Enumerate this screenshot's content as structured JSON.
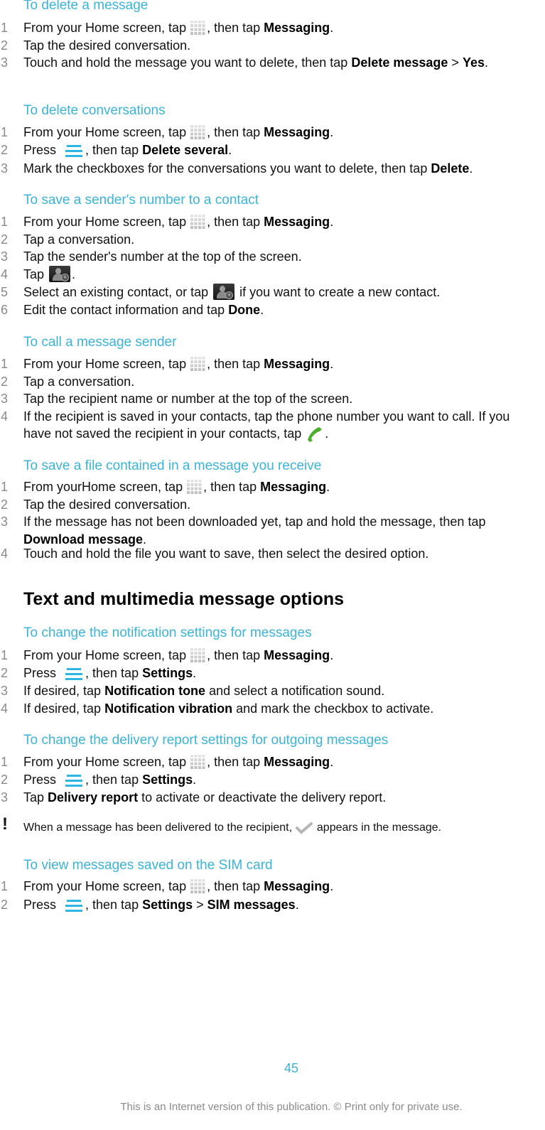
{
  "colors": {
    "heading_accent": "#3bb4d9",
    "step_number": "#8a8a8a",
    "menu_icon": "#2cb7e3",
    "phone_icon": "#4caf2f"
  },
  "procedures": [
    {
      "title": "To delete a message",
      "steps": [
        {
          "n": "1",
          "parts": [
            [
              "t",
              "From your Home screen, tap "
            ],
            [
              "icon",
              "apps-icon"
            ],
            [
              "t",
              ", then tap "
            ],
            [
              "b",
              "Messaging"
            ],
            [
              "t",
              "."
            ]
          ]
        },
        {
          "n": "2",
          "parts": [
            [
              "t",
              "Tap the desired conversation."
            ]
          ]
        },
        {
          "n": "3",
          "parts": [
            [
              "t",
              "Touch and hold the message you want to delete, then tap "
            ],
            [
              "b",
              "Delete message"
            ],
            [
              "t",
              " > "
            ],
            [
              "b",
              "Yes"
            ],
            [
              "t",
              "."
            ]
          ]
        }
      ]
    },
    {
      "title": "To delete conversations",
      "steps": [
        {
          "n": "1",
          "parts": [
            [
              "t",
              "From your Home screen, tap "
            ],
            [
              "icon",
              "apps-icon"
            ],
            [
              "t",
              ", then tap "
            ],
            [
              "b",
              "Messaging"
            ],
            [
              "t",
              "."
            ]
          ]
        },
        {
          "n": "2",
          "parts": [
            [
              "t",
              "Press "
            ],
            [
              "icon",
              "menu-icon"
            ],
            [
              "t",
              ", then tap "
            ],
            [
              "b",
              "Delete several"
            ],
            [
              "t",
              "."
            ]
          ]
        },
        {
          "n": "3",
          "parts": [
            [
              "t",
              "Mark the checkboxes for the conversations you want to delete, then tap "
            ],
            [
              "b",
              "Delete"
            ],
            [
              "t",
              "."
            ]
          ]
        }
      ]
    },
    {
      "title": "To save a sender's number to a contact",
      "steps": [
        {
          "n": "1",
          "parts": [
            [
              "t",
              "From your Home screen, tap "
            ],
            [
              "icon",
              "apps-icon"
            ],
            [
              "t",
              ", then tap "
            ],
            [
              "b",
              "Messaging"
            ],
            [
              "t",
              "."
            ]
          ]
        },
        {
          "n": "2",
          "parts": [
            [
              "t",
              "Tap a conversation."
            ]
          ]
        },
        {
          "n": "3",
          "parts": [
            [
              "t",
              "Tap the sender's number at the top of the screen."
            ]
          ]
        },
        {
          "n": "4",
          "parts": [
            [
              "t",
              "Tap "
            ],
            [
              "icon",
              "add-contact-icon"
            ],
            [
              "t",
              "."
            ]
          ]
        },
        {
          "n": "5",
          "parts": [
            [
              "t",
              "Select an existing contact, or tap "
            ],
            [
              "icon",
              "add-contact-icon"
            ],
            [
              "t",
              " if you want to create a new contact."
            ]
          ]
        },
        {
          "n": "6",
          "parts": [
            [
              "t",
              "Edit the contact information and tap "
            ],
            [
              "b",
              "Done"
            ],
            [
              "t",
              "."
            ]
          ]
        }
      ]
    },
    {
      "title": "To call a message sender",
      "steps": [
        {
          "n": "1",
          "parts": [
            [
              "t",
              "From your Home screen, tap "
            ],
            [
              "icon",
              "apps-icon"
            ],
            [
              "t",
              ", then tap "
            ],
            [
              "b",
              "Messaging"
            ],
            [
              "t",
              "."
            ]
          ]
        },
        {
          "n": "2",
          "parts": [
            [
              "t",
              "Tap a conversation."
            ]
          ]
        },
        {
          "n": "3",
          "parts": [
            [
              "t",
              "Tap the recipient name or number at the top of the screen."
            ]
          ]
        },
        {
          "n": "4",
          "parts": [
            [
              "t",
              "If the recipient is saved in your contacts, tap the phone number you want to call. If you have not saved the recipient in your contacts, tap "
            ],
            [
              "icon",
              "phone-icon"
            ],
            [
              "t",
              "."
            ]
          ]
        }
      ]
    },
    {
      "title": "To save a file contained in a message you receive",
      "steps": [
        {
          "n": "1",
          "parts": [
            [
              "t",
              "From yourHome screen, tap "
            ],
            [
              "icon",
              "apps-icon"
            ],
            [
              "t",
              ", then tap "
            ],
            [
              "b",
              "Messaging"
            ],
            [
              "t",
              "."
            ]
          ]
        },
        {
          "n": "2",
          "parts": [
            [
              "t",
              "Tap the desired conversation."
            ]
          ]
        },
        {
          "n": "3",
          "parts": [
            [
              "t",
              "If the message has not been downloaded yet, tap and hold the message, then tap "
            ],
            [
              "b",
              "Download message"
            ],
            [
              "t",
              "."
            ]
          ]
        },
        {
          "n": "4",
          "parts": [
            [
              "t",
              "Touch and hold the file you want to save, then select the desired option."
            ]
          ]
        }
      ]
    },
    {
      "title": "To change the notification settings for messages",
      "steps": [
        {
          "n": "1",
          "parts": [
            [
              "t",
              "From your Home screen, tap "
            ],
            [
              "icon",
              "apps-icon"
            ],
            [
              "t",
              ", then tap "
            ],
            [
              "b",
              "Messaging"
            ],
            [
              "t",
              "."
            ]
          ]
        },
        {
          "n": "2",
          "parts": [
            [
              "t",
              "Press "
            ],
            [
              "icon",
              "menu-icon"
            ],
            [
              "t",
              ", then tap "
            ],
            [
              "b",
              "Settings"
            ],
            [
              "t",
              "."
            ]
          ]
        },
        {
          "n": "3",
          "parts": [
            [
              "t",
              "If desired, tap "
            ],
            [
              "b",
              "Notification tone"
            ],
            [
              "t",
              " and select a notification sound."
            ]
          ]
        },
        {
          "n": "4",
          "parts": [
            [
              "t",
              "If desired, tap "
            ],
            [
              "b",
              "Notification vibration"
            ],
            [
              "t",
              " and mark the checkbox to activate."
            ]
          ]
        }
      ]
    },
    {
      "title": "To change the delivery report settings for outgoing messages",
      "steps": [
        {
          "n": "1",
          "parts": [
            [
              "t",
              "From your Home screen, tap "
            ],
            [
              "icon",
              "apps-icon"
            ],
            [
              "t",
              ", then tap "
            ],
            [
              "b",
              "Messaging"
            ],
            [
              "t",
              "."
            ]
          ]
        },
        {
          "n": "2",
          "parts": [
            [
              "t",
              "Press "
            ],
            [
              "icon",
              "menu-icon"
            ],
            [
              "t",
              ", then tap "
            ],
            [
              "b",
              "Settings"
            ],
            [
              "t",
              "."
            ]
          ]
        },
        {
          "n": "3",
          "parts": [
            [
              "t",
              "Tap "
            ],
            [
              "b",
              "Delivery report"
            ],
            [
              "t",
              " to activate or deactivate the delivery report."
            ]
          ]
        }
      ]
    },
    {
      "title": "To view messages saved on the SIM card",
      "steps": [
        {
          "n": "1",
          "parts": [
            [
              "t",
              "From your Home screen, tap "
            ],
            [
              "icon",
              "apps-icon"
            ],
            [
              "t",
              ", then tap "
            ],
            [
              "b",
              "Messaging"
            ],
            [
              "t",
              "."
            ]
          ]
        },
        {
          "n": "2",
          "parts": [
            [
              "t",
              "Press "
            ],
            [
              "icon",
              "menu-icon"
            ],
            [
              "t",
              ", then tap "
            ],
            [
              "b",
              "Settings"
            ],
            [
              "t",
              " > "
            ],
            [
              "b",
              "SIM messages"
            ],
            [
              "t",
              "."
            ]
          ]
        }
      ]
    }
  ],
  "section_heading": "Text and multimedia message options",
  "note": {
    "icon": "exclamation-icon",
    "parts": [
      [
        "t",
        "When a message has been delivered to the recipient, "
      ],
      [
        "icon",
        "delivered-check-icon"
      ],
      [
        "t",
        " appears in the message."
      ]
    ]
  },
  "page_number": "45",
  "footer": "This is an Internet version of this publication. © Print only for private use."
}
